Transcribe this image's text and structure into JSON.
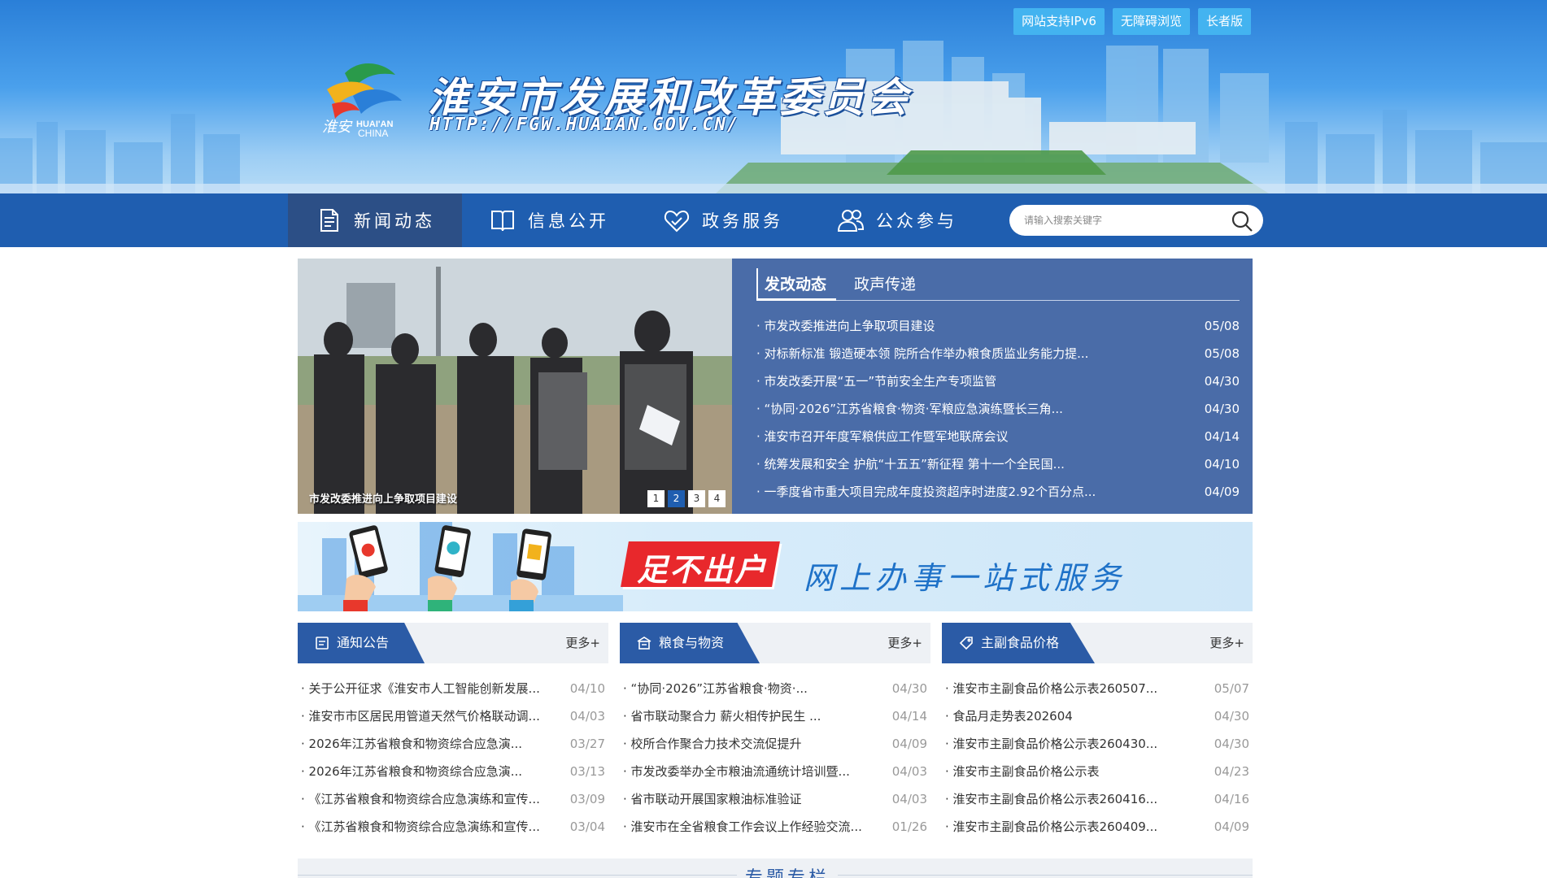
{
  "header": {
    "title": "淮安市发展和改革委员会",
    "url": "HTTP://FGW.HUAIAN.GOV.CN/",
    "top_buttons": [
      "网站支持IPv6",
      "无障碍浏览",
      "长者版"
    ]
  },
  "nav": {
    "items": [
      {
        "label": "新闻动态",
        "icon": "news-doc-icon"
      },
      {
        "label": "信息公开",
        "icon": "open-book-icon"
      },
      {
        "label": "政务服务",
        "icon": "handshake-heart-icon"
      },
      {
        "label": "公众参与",
        "icon": "people-icon"
      }
    ],
    "search_placeholder": "请输入搜索关键字"
  },
  "slider": {
    "caption": "市发改委推进向上争取项目建设",
    "dots": [
      "1",
      "2",
      "3",
      "4"
    ],
    "active_dot": 2
  },
  "news": {
    "tabs": [
      "发改动态",
      "政声传递"
    ],
    "items": [
      {
        "title": "市发改委推进向上争取项目建设",
        "date": "05/08"
      },
      {
        "title": "对标新标准 锻造硬本领 院所合作举办粮食质监业务能力提...",
        "date": "05/08"
      },
      {
        "title": "市发改委开展“五一”节前安全生产专项监管",
        "date": "04/30"
      },
      {
        "title": "“协同·2026”江苏省粮食·物资·军粮应急演练暨长三角...",
        "date": "04/30"
      },
      {
        "title": "淮安市召开年度军粮供应工作暨军地联席会议",
        "date": "04/14"
      },
      {
        "title": "统筹发展和安全 护航“十五五”新征程 第十一个全民国...",
        "date": "04/10"
      },
      {
        "title": "一季度省市重大项目完成年度投资超序时进度2.92个百分点...",
        "date": "04/09"
      }
    ]
  },
  "banner": {
    "red_text": "足不出户",
    "blue_text": "网上办事一站式服务"
  },
  "columns": [
    {
      "title": "通知公告",
      "icon": "notice-icon",
      "more": "更多+",
      "items": [
        {
          "title": "关于公开征求《淮安市人工智能创新发展...",
          "date": "04/10"
        },
        {
          "title": "淮安市市区居民用管道天然气价格联动调...",
          "date": "04/03"
        },
        {
          "title": "2026年江苏省粮食和物资综合应急演...",
          "date": "03/27"
        },
        {
          "title": "2026年江苏省粮食和物资综合应急演...",
          "date": "03/13"
        },
        {
          "title": "《江苏省粮食和物资综合应急演练和宣传...",
          "date": "03/09"
        },
        {
          "title": "《江苏省粮食和物资综合应急演练和宣传...",
          "date": "03/04"
        }
      ]
    },
    {
      "title": "粮食与物资",
      "icon": "granary-icon",
      "more": "更多+",
      "items": [
        {
          "title": "“协同·2026”江苏省粮食·物资·...",
          "date": "04/30"
        },
        {
          "title": "省市联动聚合力 薪火相传护民生 ...",
          "date": "04/14"
        },
        {
          "title": "校所合作聚合力技术交流促提升",
          "date": "04/09"
        },
        {
          "title": "市发改委举办全市粮油流通统计培训暨...",
          "date": "04/03"
        },
        {
          "title": "省市联动开展国家粮油标准验证",
          "date": "04/03"
        },
        {
          "title": "淮安市在全省粮食工作会议上作经验交流...",
          "date": "01/26"
        }
      ]
    },
    {
      "title": "主副食品价格",
      "icon": "price-tag-icon",
      "more": "更多+",
      "items": [
        {
          "title": "淮安市主副食品价格公示表260507...",
          "date": "05/07"
        },
        {
          "title": "食品月走势表202604",
          "date": "04/30"
        },
        {
          "title": "淮安市主副食品价格公示表260430...",
          "date": "04/30"
        },
        {
          "title": "淮安市主副食品价格公示表",
          "date": "04/23"
        },
        {
          "title": "淮安市主副食品价格公示表260416...",
          "date": "04/16"
        },
        {
          "title": "淮安市主副食品价格公示表260409...",
          "date": "04/09"
        }
      ]
    }
  ],
  "special": {
    "title": "专题专栏"
  }
}
